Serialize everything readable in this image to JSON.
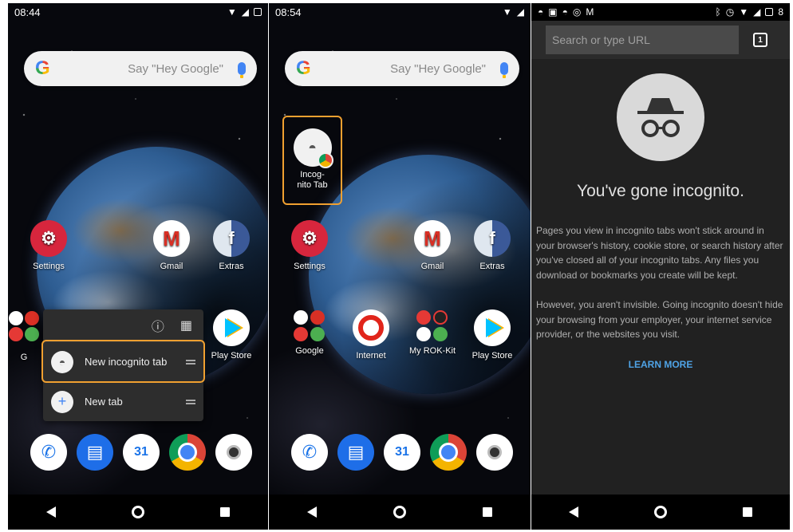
{
  "phone1": {
    "status": {
      "time": "08:44"
    },
    "search": {
      "hint": "Say \"Hey Google\""
    },
    "apps": {
      "settings": "Settings",
      "gmail": "Gmail",
      "extras": "Extras",
      "google_partial": "G",
      "play_store": "Play Store"
    },
    "shortcut_menu": {
      "new_incognito_tab": "New incognito tab",
      "new_tab": "New tab",
      "info_icon": "ⓘ",
      "widgets_icon": "▦"
    },
    "dock": {
      "calendar_day": "31"
    }
  },
  "phone2": {
    "status": {
      "time": "08:54"
    },
    "search": {
      "hint": "Say \"Hey Google\""
    },
    "shortcut": {
      "label_line1": "Incog-",
      "label_line2": "nito Tab"
    },
    "apps": {
      "settings": "Settings",
      "gmail": "Gmail",
      "extras": "Extras",
      "google": "Google",
      "internet": "Internet",
      "rok": "My ROK-Kit",
      "play_store": "Play Store"
    },
    "dock": {
      "calendar_day": "31"
    }
  },
  "phone3": {
    "status": {
      "right": "8"
    },
    "url_placeholder": "Search or type URL",
    "tab_count": "1",
    "title": "You've gone incognito.",
    "para1": "Pages you view in incognito tabs won't stick around in your browser's history, cookie store, or search history after you've closed all of your incognito tabs. Any files you download or bookmarks you create will be kept.",
    "para2": "However, you aren't invisible. Going incognito doesn't hide your browsing from your employer, your internet service provider, or the websites you visit.",
    "learn_more": "LEARN MORE"
  },
  "colors": {
    "highlight": "#f0a030",
    "link": "#4fa3e6",
    "incognito_bg": "#212121"
  }
}
